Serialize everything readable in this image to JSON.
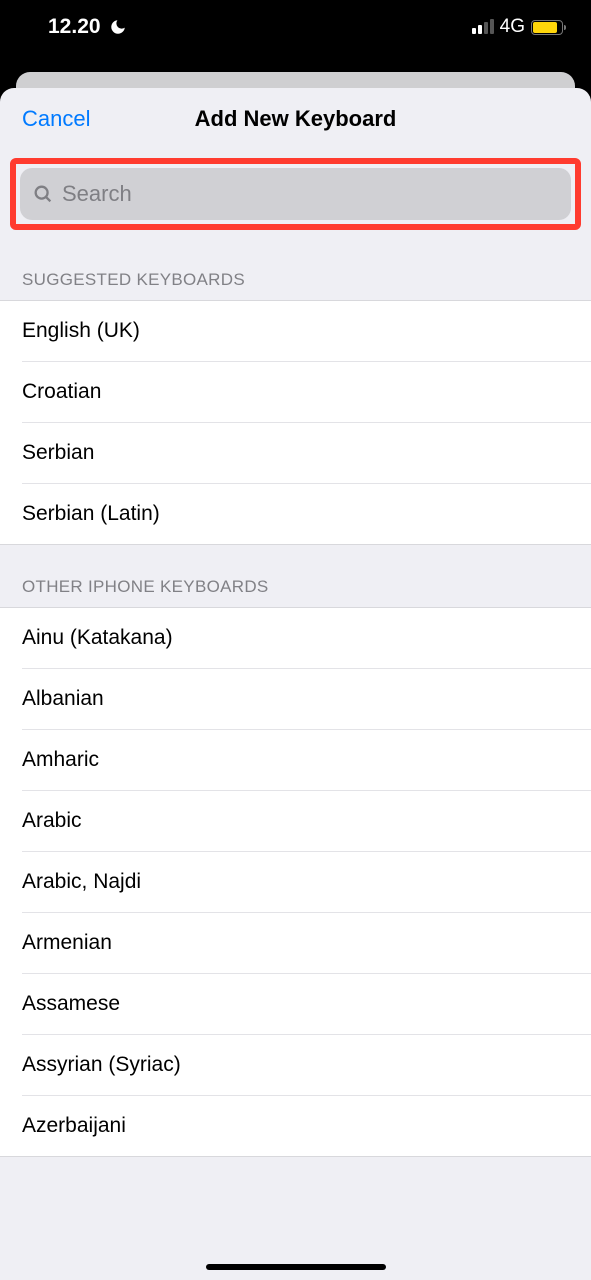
{
  "statusBar": {
    "time": "12.20",
    "networkType": "4G"
  },
  "modal": {
    "cancelLabel": "Cancel",
    "title": "Add New Keyboard",
    "searchPlaceholder": "Search"
  },
  "sections": {
    "suggested": {
      "header": "SUGGESTED KEYBOARDS",
      "items": [
        "English (UK)",
        "Croatian",
        "Serbian",
        "Serbian (Latin)"
      ]
    },
    "other": {
      "header": "OTHER IPHONE KEYBOARDS",
      "items": [
        "Ainu (Katakana)",
        "Albanian",
        "Amharic",
        "Arabic",
        "Arabic, Najdi",
        "Armenian",
        "Assamese",
        "Assyrian (Syriac)",
        "Azerbaijani"
      ]
    }
  }
}
